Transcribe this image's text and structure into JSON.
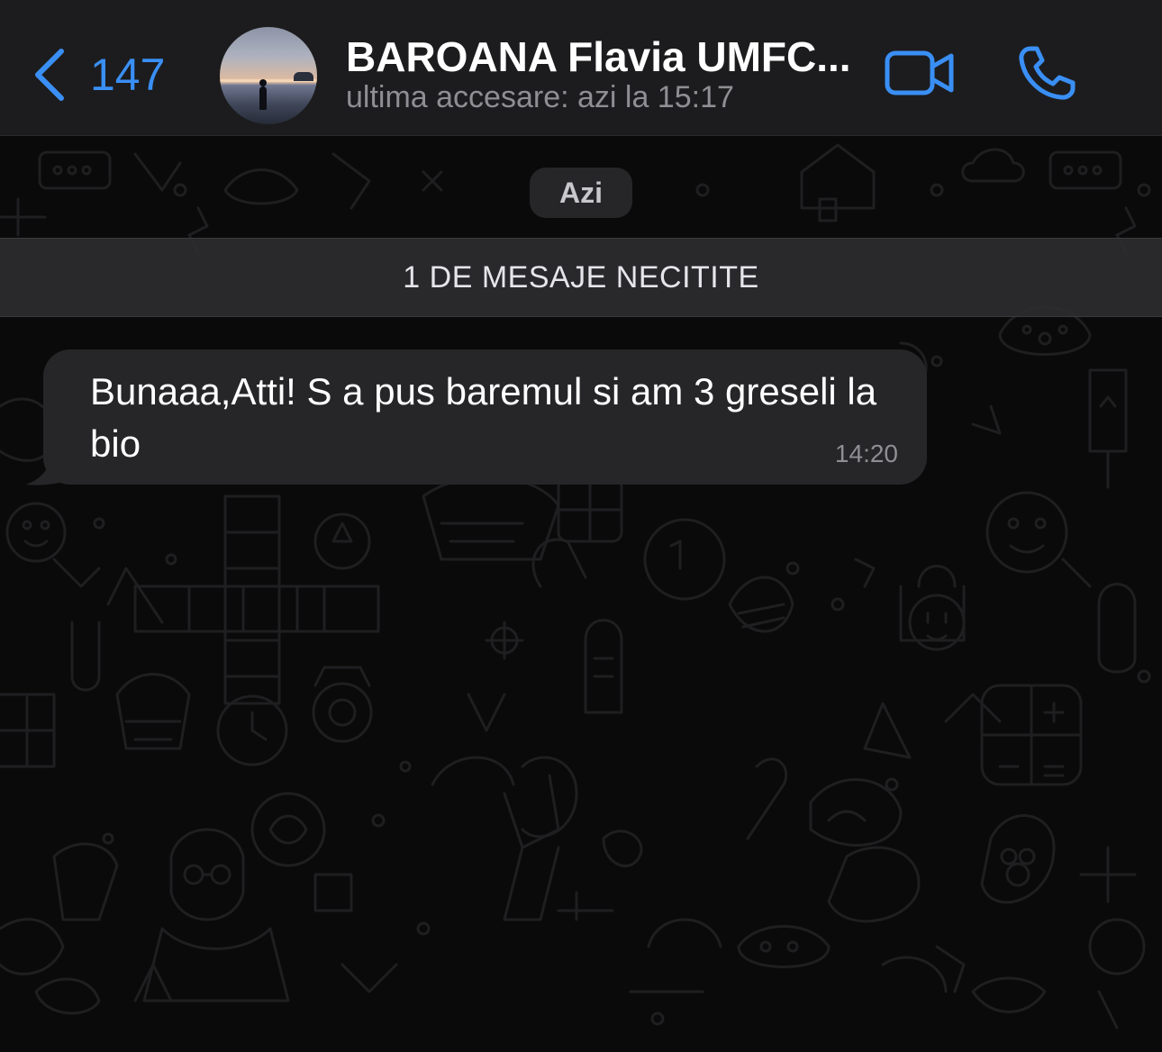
{
  "header": {
    "back_count": "147",
    "contact_name": "BAROANA Flavia UMFC...",
    "last_seen": "ultima accesare: azi la 15:17",
    "icons": {
      "back": "chevron-left-icon",
      "video": "video-camera-icon",
      "call": "phone-icon"
    }
  },
  "chat": {
    "date_label": "Azi",
    "unread_banner": "1 DE MESAJE NECITITE",
    "messages": [
      {
        "direction": "incoming",
        "text": "Bunaaa,Atti! S a pus baremul si am 3 greseli la bio",
        "time": "14:20"
      }
    ]
  },
  "colors": {
    "accent": "#3a8ff5",
    "header_bg": "#1c1c1e",
    "bubble_bg": "#262628",
    "wallpaper_bg": "#0a0a0a"
  }
}
